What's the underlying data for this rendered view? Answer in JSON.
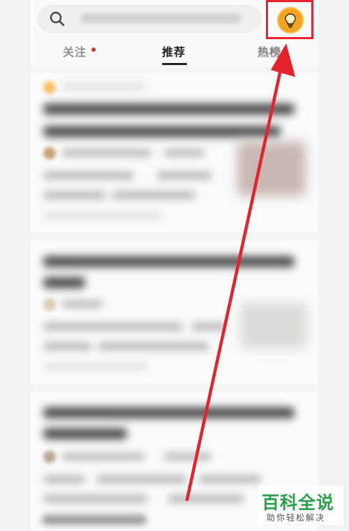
{
  "tabs": {
    "follow": "关注",
    "recommend": "推荐",
    "hot": "热榜"
  },
  "active_tab": "推荐",
  "accent_colors": {
    "highlight_box": "#e8212f",
    "bulb": "#f3a41e",
    "notification_dot": "#e2332d",
    "watermark": "#2aa24b"
  },
  "icons": [
    "search-icon",
    "lightbulb-icon"
  ],
  "watermark": {
    "title": "百科全说",
    "subtitle": "助你轻松解决"
  }
}
